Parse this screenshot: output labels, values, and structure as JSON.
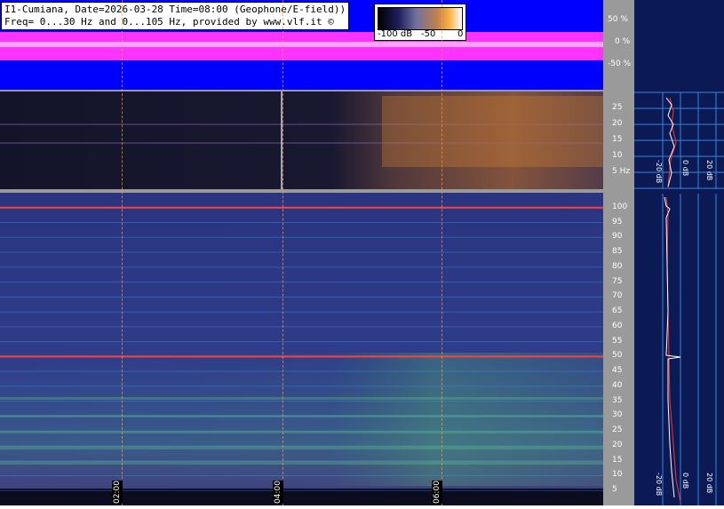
{
  "header": {
    "line1": "I1-Cumiana, Date=2026-03-28 Time=08:00 (Geophone/E-field))",
    "line2": "Freq= 0...30 Hz and 0...105 Hz, provided by www.vlf.it ©"
  },
  "colorbar": {
    "ticks": [
      "-100 dB",
      "-50",
      "0"
    ]
  },
  "waveform_scale": [
    "50 %",
    "0 %",
    "-50 %"
  ],
  "geophone_axis": [
    "25",
    "20",
    "15",
    "10",
    "5 Hz"
  ],
  "efield_axis": [
    "100",
    "95",
    "90",
    "85",
    "80",
    "75",
    "70",
    "65",
    "60",
    "55",
    "50",
    "45",
    "40",
    "35",
    "30",
    "25",
    "20",
    "15",
    "10",
    "5"
  ],
  "profile_labels_top": [
    "-20 dB",
    "0 dB",
    "20 dB"
  ],
  "profile_labels_bottom": [
    "-20 dB",
    "0 dB",
    "20 dB"
  ],
  "time_markers": [
    "02:00",
    "04:00",
    "06:00"
  ],
  "colors": {
    "waveform_bg": "#0000ff",
    "waveform_trace": "#ff33ff",
    "geophone_bg": "#08081a",
    "efield_bg": "#2a3680",
    "profile_bg": "#0b1a55",
    "scale_grey": "#9a9a9a",
    "grid_orange": "#ff9a40",
    "grid_cyan": "#40a0ff",
    "mains_line": "#ff4040"
  }
}
